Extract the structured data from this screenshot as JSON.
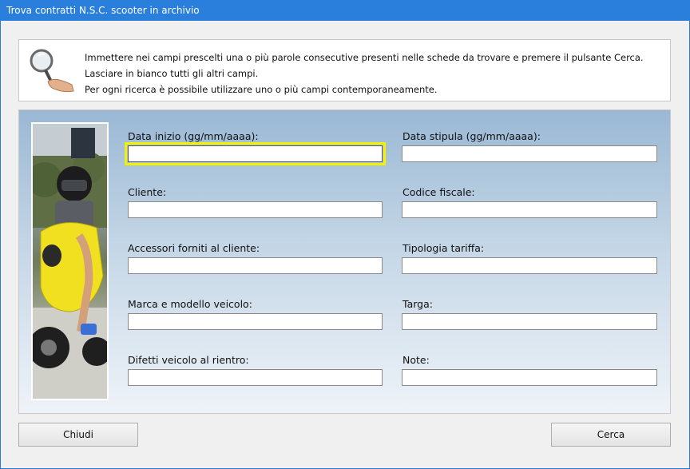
{
  "window": {
    "title": "Trova contratti N.S.C. scooter in archivio"
  },
  "info": {
    "line1": "Immettere nei campi prescelti una o più parole consecutive presenti nelle schede da trovare e premere il pulsante Cerca.",
    "line2": "Lasciare in bianco tutti gli altri campi.",
    "line3": "Per ogni ricerca è possibile utilizzare uno o più campi contemporaneamente."
  },
  "fields": {
    "data_inizio": {
      "label": "Data inizio (gg/mm/aaaa):",
      "value": ""
    },
    "data_stipula": {
      "label": "Data stipula (gg/mm/aaaa):",
      "value": ""
    },
    "cliente": {
      "label": "Cliente:",
      "value": ""
    },
    "codice_fiscale": {
      "label": "Codice fiscale:",
      "value": ""
    },
    "accessori": {
      "label": "Accessori forniti al cliente:",
      "value": ""
    },
    "tipologia_tariffa": {
      "label": "Tipologia tariffa:",
      "value": ""
    },
    "marca_modello": {
      "label": "Marca e modello veicolo:",
      "value": ""
    },
    "targa": {
      "label": "Targa:",
      "value": ""
    },
    "difetti": {
      "label": "Difetti veicolo al rientro:",
      "value": ""
    },
    "note": {
      "label": "Note:",
      "value": ""
    }
  },
  "buttons": {
    "close": "Chiudi",
    "search": "Cerca"
  },
  "colors": {
    "titlebar": "#2b7fdc",
    "focus_highlight": "#f2f200",
    "panel_top": "#9ab8d4"
  }
}
